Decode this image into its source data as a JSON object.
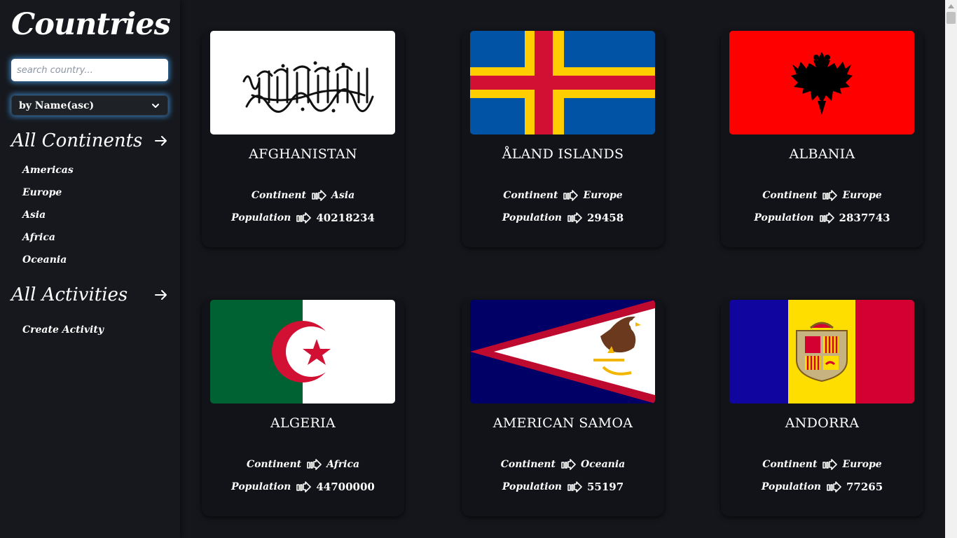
{
  "sidebar": {
    "title": "Countries",
    "search_placeholder": "search country...",
    "sort_selected": "by Name(asc)",
    "continents_heading": "All Continents",
    "continents": [
      "Americas",
      "Europe",
      "Asia",
      "Africa",
      "Oceania"
    ],
    "activities_heading": "All Activities",
    "activities": [
      "Create Activity"
    ]
  },
  "card_labels": {
    "continent": "Continent",
    "population": "Population"
  },
  "countries": [
    {
      "name": "AFGHANISTAN",
      "continent": "Asia",
      "population": "40218234",
      "flag_icon": "afghanistan-flag-icon"
    },
    {
      "name": "ÅLAND ISLANDS",
      "continent": "Europe",
      "population": "29458",
      "flag_icon": "aland-islands-flag-icon"
    },
    {
      "name": "ALBANIA",
      "continent": "Europe",
      "population": "2837743",
      "flag_icon": "albania-flag-icon"
    },
    {
      "name": "ALGERIA",
      "continent": "Africa",
      "population": "44700000",
      "flag_icon": "algeria-flag-icon"
    },
    {
      "name": "AMERICAN SAMOA",
      "continent": "Oceania",
      "population": "55197",
      "flag_icon": "american-samoa-flag-icon"
    },
    {
      "name": "ANDORRA",
      "continent": "Europe",
      "population": "77265",
      "flag_icon": "andorra-flag-icon"
    }
  ],
  "colors": {
    "page_background": "#14161b",
    "card_background": "#121318",
    "search_glow": "#46a0f0",
    "text": "#ffffff"
  }
}
